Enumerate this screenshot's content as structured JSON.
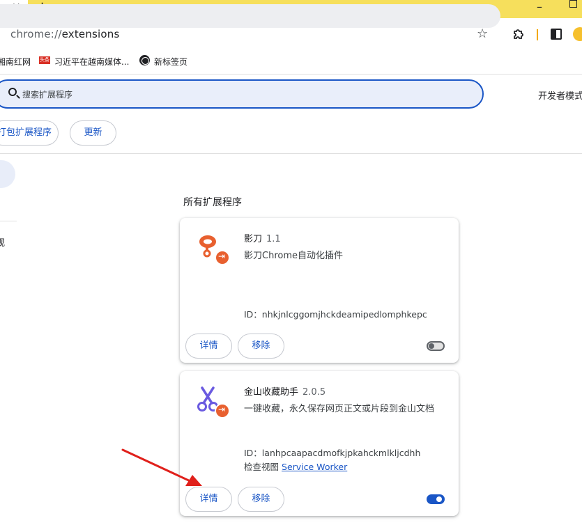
{
  "browser": {
    "tab_close": "✕",
    "new_tab": "+",
    "min": "–",
    "url_host": "chrome://",
    "url_path": "extensions"
  },
  "bookmarks": [
    {
      "label": "湘南红网"
    },
    {
      "flag": "头条",
      "label": "习近平在越南媒体..."
    },
    {
      "label": "新标签页"
    }
  ],
  "extensions_page": {
    "search_placeholder": "搜索扩展程序",
    "developer_mode_label": "开发者模式",
    "pack_button": "打包扩展程序",
    "update_button": "更新",
    "sidebar_item": "视",
    "section_title": "所有扩展程序"
  },
  "cards": [
    {
      "name": "影刀",
      "version": "1.1",
      "description": "影刀Chrome自动化插件",
      "id_text": "ID：nhkjnlcggomjhckdeamipedlomphkepc",
      "details": "详情",
      "remove": "移除",
      "enabled": false,
      "logo_color": "#e8602f"
    },
    {
      "name": "金山收藏助手",
      "version": "2.0.5",
      "description": "一键收藏，永久保存网页正文或片段到金山文档",
      "id_text": "ID：lanhpcaapacdmofkjpkahckmlkljcdhh",
      "inspect_label": "检查视图",
      "inspect_link": "Service Worker",
      "details": "详情",
      "remove": "移除",
      "enabled": true,
      "logo_color": "#6a5ae0"
    }
  ],
  "colors": {
    "accent": "#1a56c6",
    "tabbar": "#f6df5c",
    "annotation": "#e0201b"
  }
}
